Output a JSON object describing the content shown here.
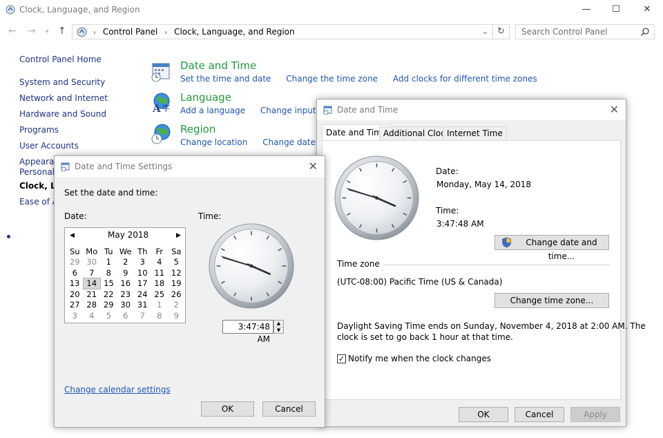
{
  "window": {
    "title": "Clock, Language, and Region",
    "minimize": "—",
    "maximize": "☐",
    "close": "✕"
  },
  "address": {
    "crumbs": [
      "Control Panel",
      "Clock, Language, and Region"
    ],
    "search_placeholder": "Search Control Panel"
  },
  "sidebar": {
    "items": [
      "Control Panel Home",
      "System and Security",
      "Network and Internet",
      "Hardware and Sound",
      "Programs",
      "User Accounts",
      "Appearance and",
      "Personalization",
      "Clock, Language, and Region",
      "Ease of Access"
    ]
  },
  "categories": [
    {
      "title": "Date and Time",
      "links": [
        "Set the time and date",
        "Change the time zone",
        "Add clocks for different time zones"
      ],
      "icon": "calendar-clock-icon"
    },
    {
      "title": "Language",
      "links": [
        "Add a language",
        "Change input methods"
      ],
      "icon": "globe-language-icon"
    },
    {
      "title": "Region",
      "links": [
        "Change location",
        "Change date, time, or number formats"
      ],
      "icon": "globe-clock-icon"
    }
  ],
  "date_time_dialog": {
    "title": "Date and Time",
    "tabs": [
      "Date and Time",
      "Additional Clocks",
      "Internet Time"
    ],
    "date_label": "Date:",
    "date_value": "Monday, May 14, 2018",
    "time_label": "Time:",
    "time_value": "3:47:48 AM",
    "change_datetime_button": "Change date and time...",
    "timezone_section": "Time zone",
    "timezone_value": "(UTC-08:00) Pacific Time (US & Canada)",
    "change_timezone_button": "Change time zone...",
    "dst_line1": "Daylight Saving Time ends on Sunday, November 4, 2018 at 2:00 AM. The",
    "dst_line2": "clock is set to go back 1 hour at that time.",
    "notify_label": "Notify me when the clock changes",
    "notify_checked": true,
    "ok": "OK",
    "cancel": "Cancel",
    "apply": "Apply"
  },
  "settings_dialog": {
    "title": "Date and Time Settings",
    "instruction": "Set the date and time:",
    "date_label": "Date:",
    "time_label": "Time:",
    "calendar": {
      "month": "May 2018",
      "prev": "◀",
      "next": "▶",
      "weekdays": [
        "Su",
        "Mo",
        "Tu",
        "We",
        "Th",
        "Fr",
        "Sa"
      ],
      "weeks": [
        [
          "29",
          "30",
          "1",
          "2",
          "3",
          "4",
          "5"
        ],
        [
          "6",
          "7",
          "8",
          "9",
          "10",
          "11",
          "12"
        ],
        [
          "13",
          "14",
          "15",
          "16",
          "17",
          "18",
          "19"
        ],
        [
          "20",
          "21",
          "22",
          "23",
          "24",
          "25",
          "26"
        ],
        [
          "27",
          "28",
          "29",
          "30",
          "31",
          "1",
          "2"
        ],
        [
          "3",
          "4",
          "5",
          "6",
          "7",
          "8",
          "9"
        ]
      ],
      "selected_day": "14"
    },
    "time_value": "3:47:48 AM",
    "change_calendar_link": "Change calendar settings",
    "ok": "OK",
    "cancel": "Cancel"
  },
  "clock": {
    "hours": 3,
    "minutes": 47,
    "seconds": 48
  }
}
